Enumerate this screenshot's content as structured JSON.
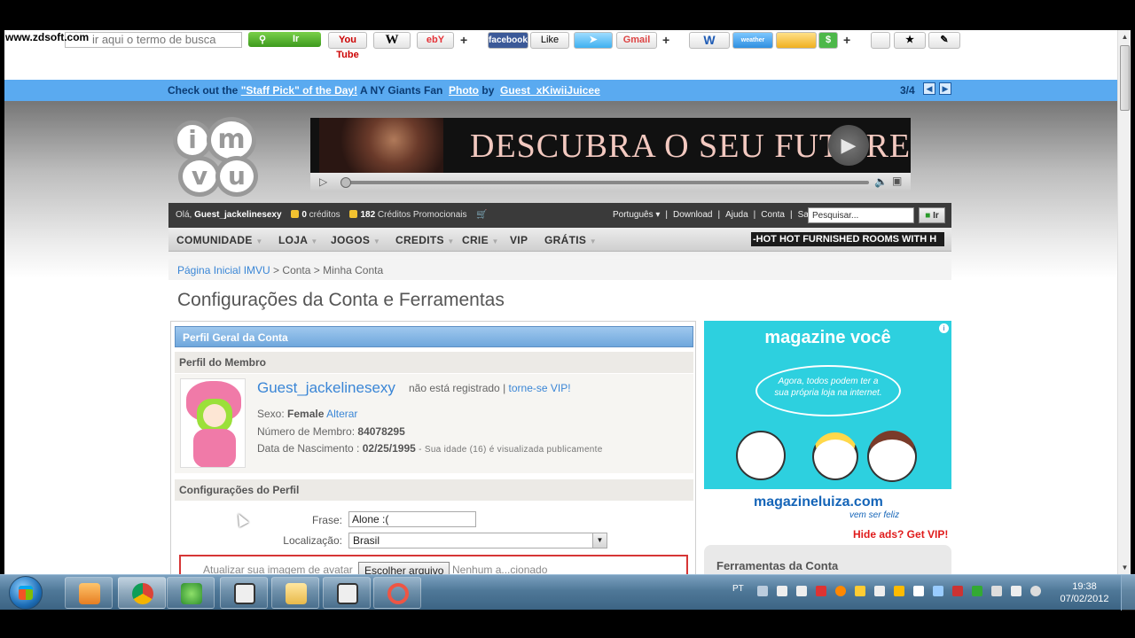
{
  "watermark": "www.zdsoft.com",
  "toolbar": {
    "search_placeholder": "ir aqui o termo de busca",
    "go_label": "Ir",
    "buttons": [
      "You Tube",
      "W",
      "ebY",
      "facebook",
      "Like",
      "",
      "Gmail",
      "W",
      "weather",
      "",
      "$",
      "",
      "",
      ""
    ]
  },
  "bluebar": {
    "prefix": "Check out the",
    "staff_pick": "\"Staff Pick\" of the Day!",
    "middle": "A NY Giants Fan",
    "photo": "Photo",
    "by": "by",
    "author": "Guest_xKiwiiJuicee",
    "counter": "3/4"
  },
  "logo_letters": [
    "i",
    "m",
    "v",
    "u"
  ],
  "banner": {
    "headline": "DESCUBRA O SEU FUTURE"
  },
  "userbar": {
    "greeting": "Olá,",
    "username": "Guest_jackelinesexy",
    "credits_count": "0",
    "credits_label": "créditos",
    "promo_count": "182",
    "promo_label": "Créditos Promocionais",
    "links": [
      "Português ▾",
      "|",
      "Download",
      "|",
      "Ajuda",
      "|",
      "Conta",
      "|",
      "Sair"
    ],
    "search_placeholder": "Pesquisar...",
    "search_btn": "Ir"
  },
  "nav": {
    "items": [
      "COMUNIDADE",
      "LOJA",
      "JOGOS",
      "CREDITS",
      "CRIE",
      "VIP",
      "GRÁTIS"
    ],
    "ticker": "-HOT HOT FURNISHED ROOMS WITH H"
  },
  "breadcrumb": {
    "home": "Página Inicial IMVU",
    "sep1": " > ",
    "account": "Conta",
    "sep2": " > ",
    "current": "Minha Conta"
  },
  "page_title": "Configurações da Conta e Ferramentas",
  "panel": {
    "header": "Perfil Geral da Conta",
    "member_header": "Perfil do Membro",
    "username": "Guest_jackelinesexy",
    "status": "não está registrado",
    "status_sep": "|",
    "vip_link": "torne-se VIP!",
    "sex_label": "Sexo:",
    "sex_value": "Female",
    "sex_change": "Alterar",
    "member_no_label": "Número de Membro:",
    "member_no": "84078295",
    "dob_label": "Data de Nascimento :",
    "dob": "02/25/1995",
    "dob_note": "- Sua idade (16) é visualizada publicamente",
    "settings_header": "Configurações do Perfil",
    "phrase_label": "Frase:",
    "phrase_value": "Alone :(",
    "location_label": "Localização:",
    "location_value": "Brasil",
    "avatar_label": "Atualizar sua imagem de avatar",
    "file_btn": "Escolher arquivo",
    "file_name": "Nenhum a...cionado"
  },
  "sidead": {
    "brand": "magazine você",
    "bubble": "Agora, todos podem ter a sua própria loja na internet.",
    "url": "magazineluiza.com",
    "tagline": "vem ser feliz",
    "info": "i"
  },
  "hide_ads": "Hide ads? Get VIP!",
  "tools_title": "Ferramentas da Conta",
  "taskbar": {
    "language": "PT",
    "time": "19:38",
    "date": "07/02/2012"
  },
  "colors": {
    "accent": "#3a86d6",
    "bluebar": "#5aaaf0",
    "alert": "#e01b1b"
  }
}
